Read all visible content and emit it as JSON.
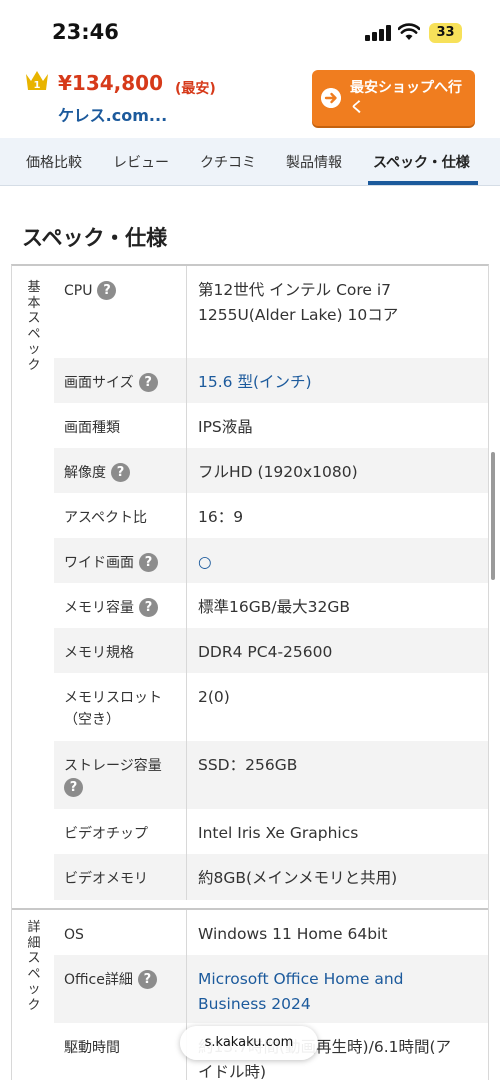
{
  "status_bar": {
    "time": "23:46",
    "battery": "33"
  },
  "header": {
    "rank_badge": "1",
    "price": "¥134,800",
    "price_note": "(最安)",
    "shop_name": "ケレス.com...",
    "cta_label": "最安ショップへ行く"
  },
  "tabs": [
    {
      "label": "価格比較"
    },
    {
      "label": "レビュー"
    },
    {
      "label": "クチコミ"
    },
    {
      "label": "製品情報"
    },
    {
      "label": "スペック・仕様",
      "active": true
    }
  ],
  "section_title": "スペック・仕様",
  "spec_groups": [
    {
      "label": "基本スペック",
      "rows": [
        {
          "key": "CPU",
          "value": "第12世代 インテル Core i7 1255U(Alder Lake) 10コア"
        },
        {
          "key": "画面サイズ",
          "value": "15.6 型(インチ)"
        },
        {
          "key": "画面種類",
          "value": "IPS液晶"
        },
        {
          "key": "解像度",
          "value": "フルHD (1920x1080)"
        },
        {
          "key": "アスペクト比",
          "value": "16：9"
        },
        {
          "key": "ワイド画面",
          "value": "○"
        },
        {
          "key": "メモリ容量",
          "value": "標準16GB/最大32GB"
        },
        {
          "key": "メモリ規格",
          "value": "DDR4 PC4-25600"
        },
        {
          "key": "メモリスロット（空き）",
          "value": "2(0)"
        },
        {
          "key": "ストレージ容量",
          "value": "SSD：256GB"
        },
        {
          "key": "ビデオチップ",
          "value": "Intel Iris Xe Graphics"
        },
        {
          "key": "ビデオメモリ",
          "value": "約8GB(メインメモリと共用)"
        }
      ]
    },
    {
      "label": "詳細スペック",
      "rows": [
        {
          "key": "OS",
          "value": "Windows 11 Home 64bit"
        },
        {
          "key": "Office詳細",
          "value": "Microsoft Office Home and Business 2024"
        },
        {
          "key": "駆動時間",
          "value": "約13.7時間(動画再生時)/6.1時間(アイドル時)"
        }
      ]
    }
  ],
  "help_glyph": "?",
  "url_bar": "s.kakaku.com",
  "colors": {
    "price": "#d63a1a",
    "link": "#1c5a9c",
    "cta": "#f07d1f",
    "tab_accent": "#1c5a9c"
  }
}
